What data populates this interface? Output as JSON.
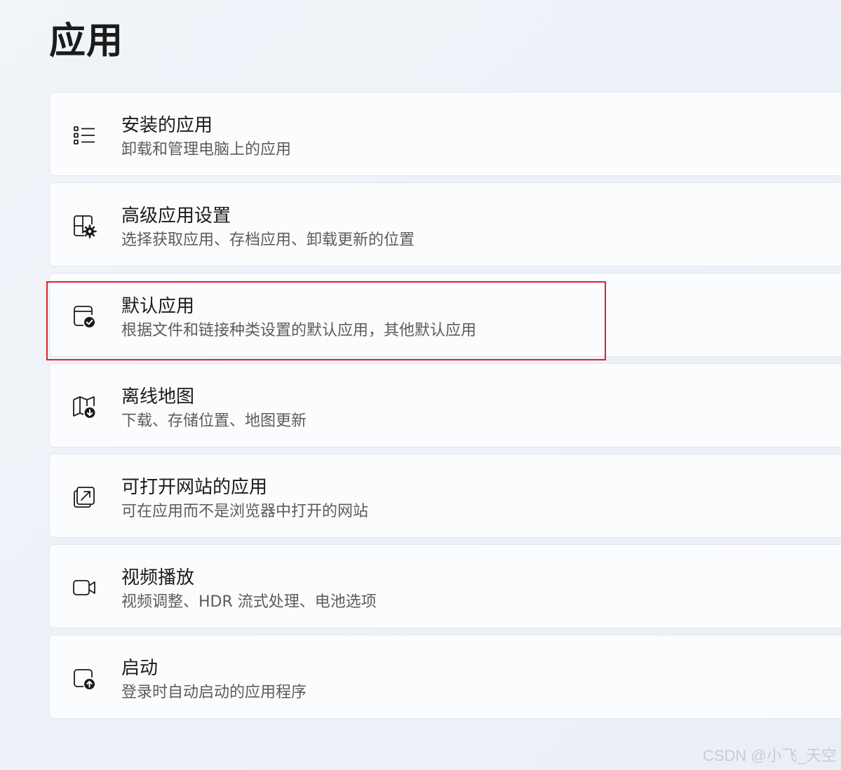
{
  "page": {
    "title": "应用"
  },
  "items": [
    {
      "icon": "list-icon",
      "title": "安装的应用",
      "subtitle": "卸载和管理电脑上的应用"
    },
    {
      "icon": "apps-settings-icon",
      "title": "高级应用设置",
      "subtitle": "选择获取应用、存档应用、卸载更新的位置"
    },
    {
      "icon": "default-apps-icon",
      "title": "默认应用",
      "subtitle": "根据文件和链接种类设置的默认应用，其他默认应用"
    },
    {
      "icon": "offline-map-icon",
      "title": "离线地图",
      "subtitle": "下载、存储位置、地图更新"
    },
    {
      "icon": "open-website-icon",
      "title": "可打开网站的应用",
      "subtitle": "可在应用而不是浏览器中打开的网站"
    },
    {
      "icon": "video-camera-icon",
      "title": "视频播放",
      "subtitle": "视频调整、HDR 流式处理、电池选项"
    },
    {
      "icon": "startup-icon",
      "title": "启动",
      "subtitle": "登录时自动启动的应用程序"
    }
  ],
  "annotation": {
    "highlight_color": "#d9252b"
  },
  "watermark": "CSDN @小飞_天空"
}
